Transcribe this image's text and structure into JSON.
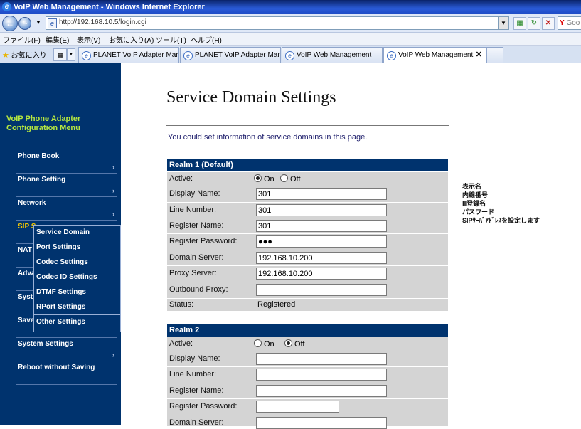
{
  "window": {
    "title": "VoIP Web Management - Windows Internet Explorer"
  },
  "browser": {
    "address": "http://192.168.10.5/login.cgi",
    "search_placeholder": "Goo",
    "menu": [
      "ファイル(F)",
      "編集(E)",
      "表示(V)",
      "お気に入り(A)",
      "ツール(T)",
      "ヘルプ(H)"
    ],
    "favorites_label": "お気に入り",
    "tabs": [
      {
        "label": "PLANET VoIP Adapter Man..."
      },
      {
        "label": "PLANET VoIP Adapter Man..."
      },
      {
        "label": "VoIP Web Management"
      },
      {
        "label": "VoIP Web Management",
        "active": true
      }
    ]
  },
  "sidebar": {
    "title_line1": "VoIP Phone Adapter",
    "title_line2": "Configuration Menu",
    "items": [
      {
        "label": "Phone Book"
      },
      {
        "label": "Phone Setting"
      },
      {
        "label": "Network"
      },
      {
        "label": "SIP S..."
      },
      {
        "label": "NAT"
      },
      {
        "label": "Adva"
      },
      {
        "label": "Syst"
      },
      {
        "label": "Save"
      },
      {
        "label": "System Settings"
      },
      {
        "label": "Reboot without Saving"
      }
    ],
    "submenu": [
      "Service Domain",
      "Port Settings",
      "Codec Settings",
      "Codec ID Settings",
      "DTMF Settings",
      "RPort Settings",
      "Other Settings"
    ]
  },
  "page": {
    "heading": "Service Domain Settings",
    "intro": "You could set information of service domains in this page."
  },
  "realm1": {
    "header": "Realm 1 (Default)",
    "labels": [
      "Active:",
      "Display Name:",
      "Line Number:",
      "Register Name:",
      "Register Password:",
      "Domain Server:",
      "Proxy Server:",
      "Outbound Proxy:",
      "Status:"
    ],
    "active_on": "On",
    "active_off": "Off",
    "active_value": "On",
    "display_name": "301",
    "line_number": "301",
    "register_name": "301",
    "register_password": "●●●",
    "domain_server": "192.168.10.200",
    "proxy_server": "192.168.10.200",
    "outbound_proxy": "",
    "status": "Registered"
  },
  "realm2": {
    "header": "Realm 2",
    "labels": [
      "Active:",
      "Display Name:",
      "Line Number:",
      "Register Name:",
      "Register Password:",
      "Domain Server:"
    ],
    "active_on": "On",
    "active_off": "Off",
    "active_value": "Off",
    "display_name": "",
    "line_number": "",
    "register_name": "",
    "register_password": "",
    "domain_server": ""
  },
  "notes": [
    "表示名",
    "内線番号",
    "Ⅲ登録名",
    "パスワード",
    "SIPｻｰﾊﾞｱﾄﾞﾚｽを設定します"
  ]
}
